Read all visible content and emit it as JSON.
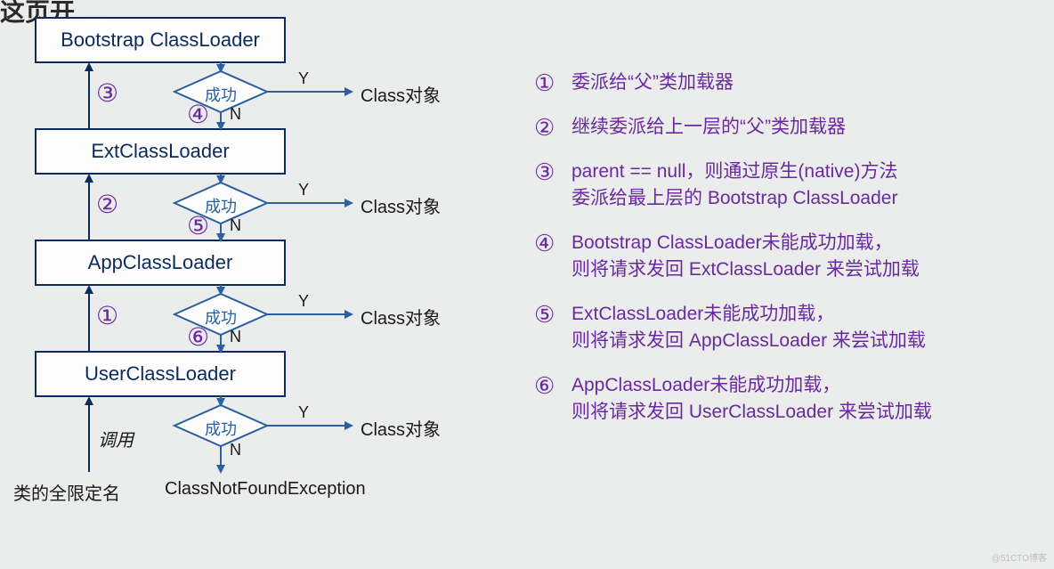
{
  "top_cut_text": "这页开 …… ",
  "flow": {
    "boxes": {
      "bootstrap": "Bootstrap ClassLoader",
      "ext": "ExtClassLoader",
      "app": "AppClassLoader",
      "user": "UserClassLoader"
    },
    "diamond_label": "成功",
    "yes": "Y",
    "no": "N",
    "class_obj": "Class对象",
    "call_label": "调用",
    "start_label": "类的全限定名",
    "not_found": "ClassNotFoundException"
  },
  "nums": {
    "n1": "①",
    "n2": "②",
    "n3": "③",
    "n4": "④",
    "n5": "⑤",
    "n6": "⑥"
  },
  "legend": {
    "l1": "委派给“父”类加载器",
    "l2": "继续委派给上一层的“父”类加载器",
    "l3": "parent == null，则通过原生(native)方法\n委派给最上层的 Bootstrap ClassLoader",
    "l4": "Bootstrap ClassLoader未能成功加载，\n则将请求发回 ExtClassLoader 来尝试加载",
    "l5": "ExtClassLoader未能成功加载，\n则将请求发回 AppClassLoader 来尝试加载",
    "l6": "AppClassLoader未能成功加载，\n则将请求发回 UserClassLoader 来尝试加载"
  },
  "watermark": "@51CTO博客"
}
